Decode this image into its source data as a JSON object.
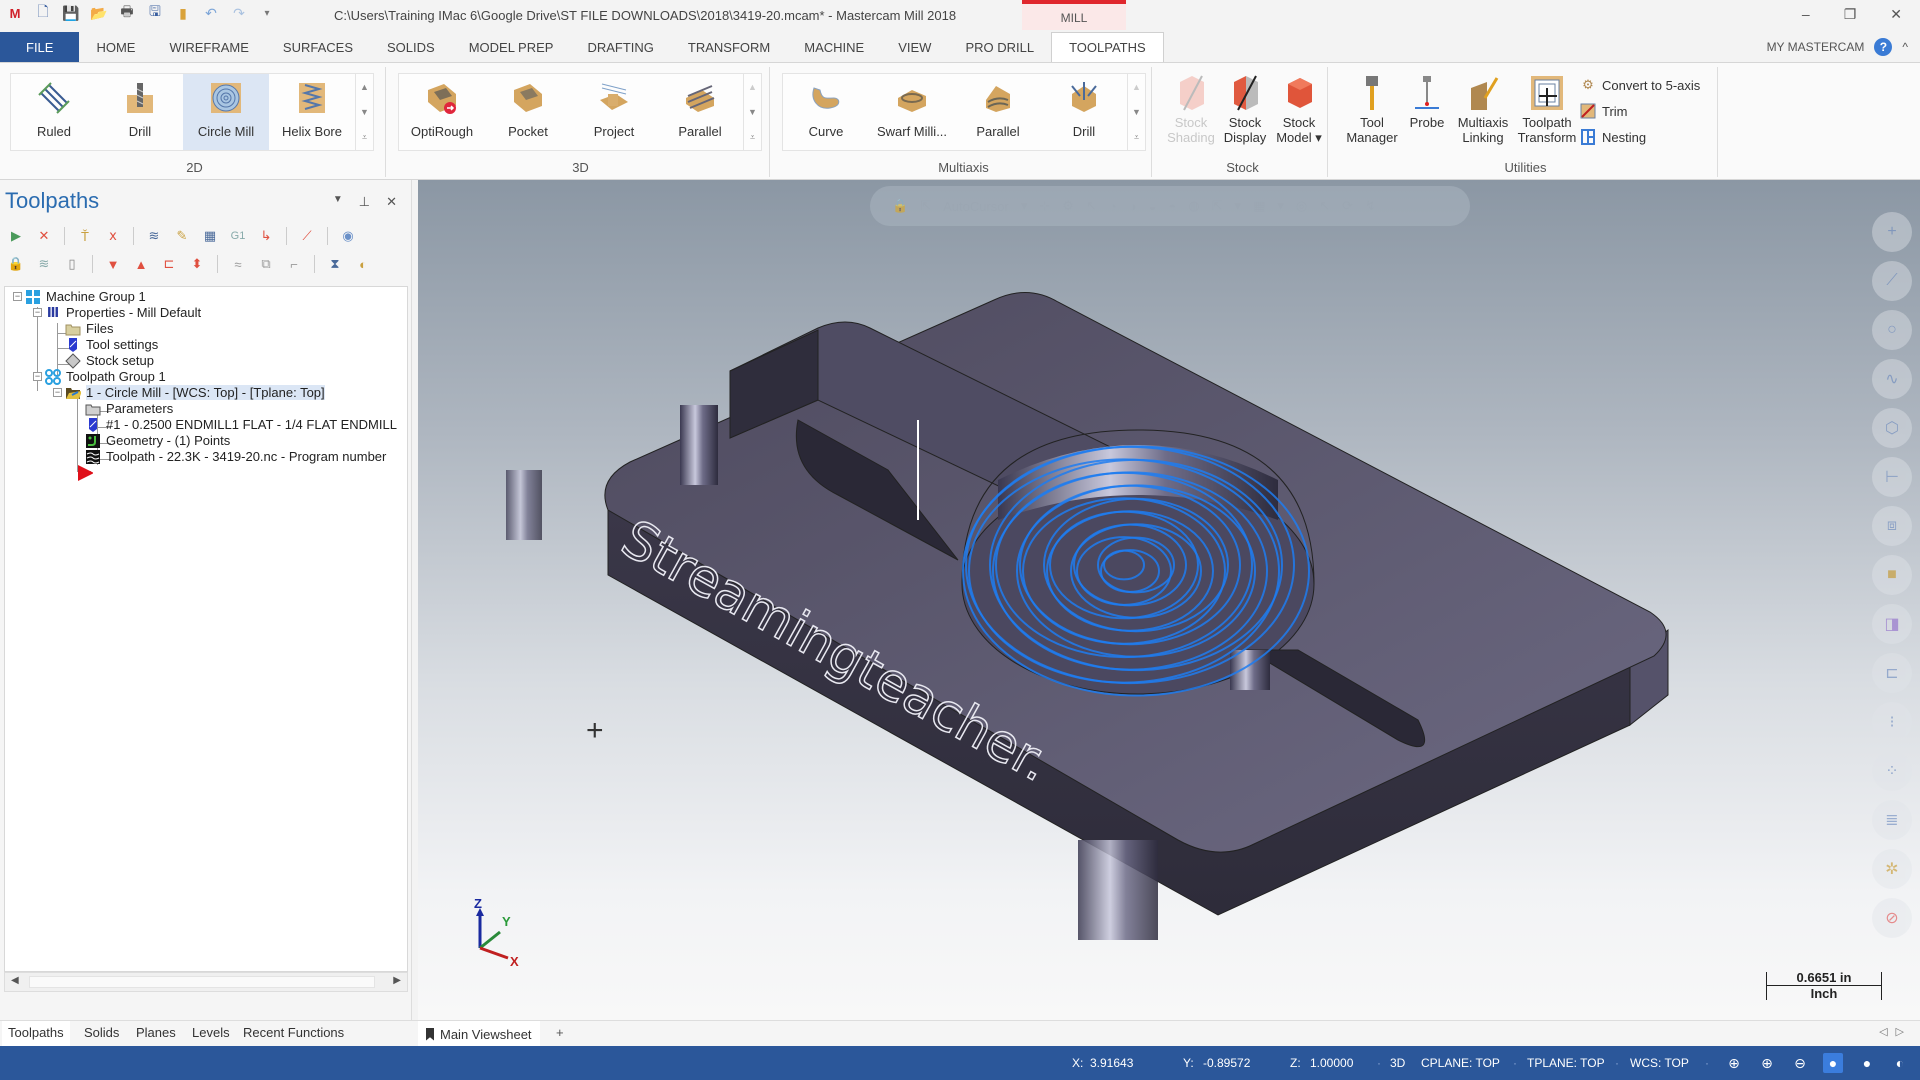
{
  "title_bar": {
    "quick_access": [
      "app-logo-icon",
      "new-file-icon",
      "save-icon",
      "open-icon",
      "print-icon",
      "save-as-icon",
      "folder-icon",
      "undo-icon",
      "redo-icon",
      "customize-icon"
    ],
    "title": "C:\\Users\\Training IMac 6\\Google Drive\\ST FILE DOWNLOADS\\2018\\3419-20.mcam* - Mastercam Mill 2018",
    "context_tab": "MILL",
    "window_controls": {
      "minimize": "–",
      "restore": "❐",
      "close": "✕"
    }
  },
  "ribbon_tabs": {
    "items": [
      "FILE",
      "HOME",
      "WIREFRAME",
      "SURFACES",
      "SOLIDS",
      "MODEL PREP",
      "DRAFTING",
      "TRANSFORM",
      "MACHINE",
      "VIEW",
      "PRO DRILL",
      "TOOLPATHS"
    ],
    "active": "TOOLPATHS",
    "my_mastercam": "MY MASTERCAM",
    "help": "?",
    "collapse": "^"
  },
  "ribbon": {
    "group_2d": {
      "label": "2D",
      "buttons": [
        "Ruled",
        "Drill",
        "Circle Mill",
        "Helix Bore"
      ],
      "selected": "Circle Mill"
    },
    "group_3d": {
      "label": "3D",
      "buttons": [
        "OptiRough",
        "Pocket",
        "Project",
        "Parallel"
      ]
    },
    "group_multiaxis": {
      "label": "Multiaxis",
      "buttons": [
        "Curve",
        "Swarf Milli...",
        "Parallel",
        "Drill"
      ]
    },
    "group_stock": {
      "label": "Stock",
      "buttons": [
        {
          "line1": "Stock",
          "line2": "Shading",
          "disabled": true
        },
        {
          "line1": "Stock",
          "line2": "Display",
          "disabled": false
        },
        {
          "line1": "Stock",
          "line2": "Model ▾",
          "disabled": false
        }
      ]
    },
    "group_utilities": {
      "label": "Utilities",
      "buttons": [
        {
          "line1": "Tool",
          "line2": "Manager"
        },
        {
          "line1": "Probe",
          "line2": ""
        },
        {
          "line1": "Multiaxis",
          "line2": "Linking"
        },
        {
          "line1": "Toolpath",
          "line2": "Transform"
        }
      ],
      "small_buttons": [
        "Convert to 5-axis",
        "Trim",
        "Nesting"
      ]
    }
  },
  "toolpaths_panel": {
    "title": "Toolpaths",
    "controls": {
      "dropdown": "▼",
      "pin": "📌",
      "close": "✕"
    },
    "tree": [
      {
        "label": "Machine Group 1",
        "icon": "machine-group-icon",
        "level": 0
      },
      {
        "label": "Properties - Mill Default",
        "icon": "properties-icon",
        "level": 1
      },
      {
        "label": "Files",
        "icon": "folder-icon",
        "level": 2
      },
      {
        "label": "Tool settings",
        "icon": "tool-icon",
        "level": 2
      },
      {
        "label": "Stock setup",
        "icon": "stock-icon",
        "level": 2
      },
      {
        "label": "Toolpath Group 1",
        "icon": "toolpath-group-icon",
        "level": 1
      },
      {
        "label": "1 - Circle Mill - [WCS: Top] - [Tplane: Top]",
        "icon": "operation-folder-icon",
        "level": 2,
        "selected": true
      },
      {
        "label": "Parameters",
        "icon": "parameters-icon",
        "level": 3
      },
      {
        "label": "#1 - 0.2500 ENDMILL1 FLAT -  1/4 FLAT ENDMILL",
        "icon": "tool-icon",
        "level": 3
      },
      {
        "label": "Geometry -  (1) Points",
        "icon": "geometry-icon",
        "level": 3
      },
      {
        "label": "Toolpath - 22.3K - 3419-20.nc - Program number",
        "icon": "toolpath-icon",
        "level": 3
      }
    ]
  },
  "viewport": {
    "toolbar_label": "AutoCursor",
    "engraved_text": "Streamingteacher.",
    "triad": {
      "x": "X",
      "y": "Y",
      "z": "Z"
    },
    "scale": {
      "value": "0.6651 in",
      "unit": "Inch"
    },
    "colors": {
      "part": "#5e5b72",
      "toolpath": "#1e7cf0"
    }
  },
  "bottom_tabs": {
    "panel_tabs": [
      "Toolpaths",
      "Solids",
      "Planes",
      "Levels",
      "Recent Functions"
    ],
    "active": "Toolpaths",
    "viewsheet": "Main Viewsheet",
    "add": "+"
  },
  "status_bar": {
    "x_label": "X:",
    "x": "3.91643",
    "y_label": "Y:",
    "y": "-0.89572",
    "z_label": "Z:",
    "z": "1.00000",
    "mode": "3D",
    "cplane": "CPLANE: TOP",
    "tplane": "TPLANE: TOP",
    "wcs": "WCS: TOP"
  }
}
